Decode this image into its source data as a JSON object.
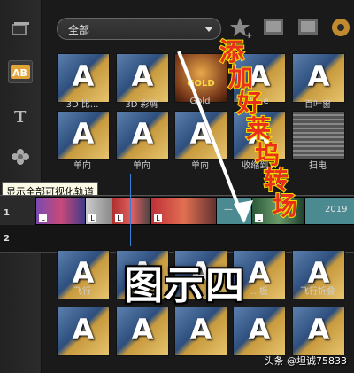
{
  "library": {
    "filter_label": "全部",
    "row1": [
      "3D 比...",
      "3D 彩屑",
      "Gold",
      "V...e",
      "",
      "百叶窗"
    ],
    "row1_gold_text": "GOLD",
    "row2": [
      "单向",
      "单向",
      "单向",
      "",
      "收缩到...",
      "扫电"
    ],
    "row3": [
      "飞行",
      "飞行",
      "",
      "",
      "...板",
      "飞行折叠",
      ""
    ],
    "row4": [
      "",
      "",
      "",
      "",
      "",
      "",
      ""
    ]
  },
  "tooltip": "显示全部可视化轨道",
  "timeline": {
    "track1_label": "1",
    "track2_label": "2",
    "clip_dash": "—",
    "clip_year": "2019"
  },
  "annotations": {
    "red_text": "添加好莱坞转场",
    "tu_text": "图示四"
  },
  "watermark": "头条 @坦诚75833",
  "colors": {
    "annotation_red": "#e8301c",
    "annotation_yellow": "#f5e000",
    "playhead": "#3a7fd8"
  }
}
